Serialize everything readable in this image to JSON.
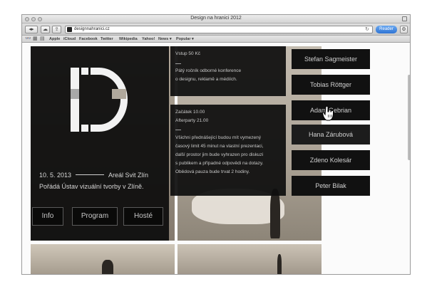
{
  "window": {
    "title": "Design na hranici 2012"
  },
  "toolbar": {
    "url": "designnahranici.cz",
    "reader_label": "Reader"
  },
  "bookmarks": {
    "items": [
      "Apple",
      "iCloud",
      "Facebook",
      "Twitter",
      "Wikipedia",
      "Yahoo!",
      "News ▾",
      "Popular ▾"
    ]
  },
  "hero": {
    "date": "10. 5. 2013",
    "venue": "Areál Svit Zlín",
    "organizer": "Pořádá Ústav vizuální tvorby v Zlíně.",
    "nav": [
      "Info",
      "Program",
      "Hosté"
    ]
  },
  "info_top": {
    "entry": "Vstup 50 Kč",
    "dash": "—",
    "line1": "Pátý ročník odborné konference",
    "line2": "o designu, reklamě a médiích."
  },
  "info_bottom": {
    "start": "Začátek 10.00",
    "afterparty": "Afterparty 21.00",
    "dash": "—",
    "lines": [
      "Všichni přednášející budou mít vymezený",
      "časový limit 45 minut na vlastní prezentaci,",
      "další prostor jim bude vyhrazen pro diskuzi",
      "s publikem a případné odpovědi na dotazy.",
      "Obědová pauza bude trvat 2 hodiny."
    ]
  },
  "speakers": [
    "Stefan Sagmeister",
    "Tobias Röttger",
    "Adam Gebrian",
    "Hana Zárubová",
    "Zdeno Kolesár",
    "Peter Bilak"
  ],
  "colors": {
    "panel": "#0c0c0c",
    "reader_blue": "#3a7fdc"
  }
}
